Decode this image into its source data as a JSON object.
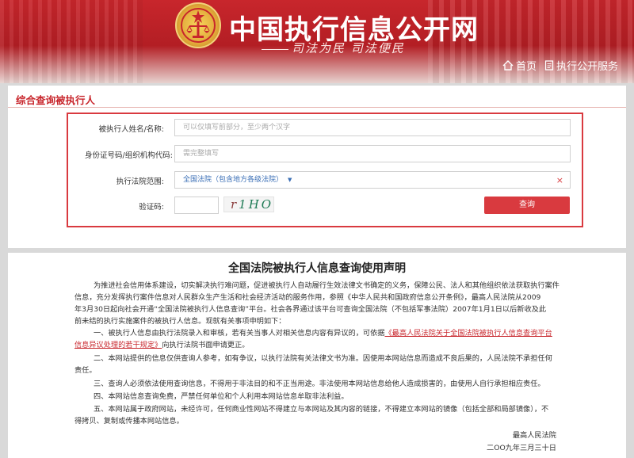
{
  "header": {
    "site_title": "中国执行信息公开网",
    "slogan": "司法为民  司法便民",
    "nav": [
      {
        "icon": "home-icon",
        "label": "首页"
      },
      {
        "icon": "document-icon",
        "label": "执行公开服务"
      }
    ]
  },
  "panel": {
    "title": "综合查询被执行人",
    "name_label": "被执行人姓名/名称:",
    "name_placeholder": "可以仅填写前部分，至少两个汉字",
    "id_label": "身份证号码/组织机构代码:",
    "id_placeholder": "需完整填写",
    "court_label": "执行法院范围:",
    "court_value": "全国法院（包含地方各级法院）",
    "captcha_label": "验证码:",
    "captcha_text": [
      "r",
      "1HO"
    ],
    "search_button": "查询"
  },
  "statement": {
    "title": "全国法院被执行人信息查询使用声明",
    "lines": [
      "为推进社会信用体系建设，切实解决执行难问题，促进被执行人自动履行生效法律文书确定的义务，保障公民、法人和其他组织依法获取执行案件",
      "信息，充分发挥执行案件信息对人民群众生产生活和社会经济活动的服务作用，参照《中华人民共和国政府信息公开条例》，最高人民法院从2009",
      "年3月30日起向社会开通“全国法院被执行人信息查询”平台。社会各界通过该平台可查询全国法院（不包括军事法院）2007年1月1日以后新收及此",
      "前未结的执行实施案件的被执行人信息。现就有关事项申明如下："
    ],
    "item1_prefix": "一、被执行人信息由执行法院录入和审核，若有关当事人对相关信息内容有异议的，可依据",
    "item1_link_a": "《最高人民法院关于全国法院被执行人信息查询平台",
    "item1_link_b": "信息异议处理的若干规定》",
    "item1_suffix": "向执行法院书面申请更正。",
    "item2_a": "二、本网站提供的信息仅供查询人参考，如有争议，以执行法院有关法律文书为准。因使用本网站信息而造成不良后果的，人民法院不承担任何",
    "item2_b": "责任。",
    "item3": "三、查询人必须依法使用查询信息，不得用于非法目的和不正当用途。非法使用本网站信息给他人造成损害的，由使用人自行承担相应责任。",
    "item4": "四、本网站信息查询免费，严禁任何单位和个人利用本网站信息牟取非法利益。",
    "item5_a": "五、本网站属于政府网站，未经许可，任何商业性网站不得建立与本网站及其内容的链接，不得建立本网站的镜像（包括全部和局部镜像），不",
    "item5_b": "得拷贝、复制或传播本网站信息。",
    "signature": "最高人民法院",
    "date": "二OO九年三月三十日"
  },
  "colors": {
    "brand_red": "#c8262c",
    "button_red": "#d93a3f",
    "link_blue": "#3b6fb6"
  }
}
